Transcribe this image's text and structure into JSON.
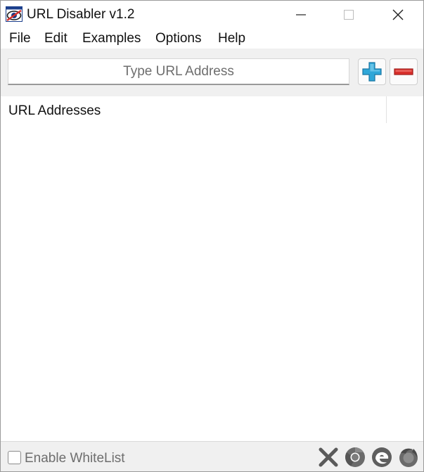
{
  "window": {
    "title": "URL Disabler v1.2"
  },
  "menu": {
    "items": [
      {
        "label": "File"
      },
      {
        "label": "Edit"
      },
      {
        "label": "Examples"
      },
      {
        "label": "Options"
      },
      {
        "label": "Help"
      }
    ]
  },
  "toolbar": {
    "url_placeholder": "Type URL Address",
    "url_value": ""
  },
  "list": {
    "column_header": "URL Addresses",
    "rows": []
  },
  "statusbar": {
    "whitelist_label": "Enable WhiteList",
    "whitelist_checked": false
  },
  "colors": {
    "add_accent": "#2fa7d8",
    "remove_accent": "#d9302c",
    "toolbar_bg": "#f0f0f0",
    "disabled_text": "#6e6e6e"
  },
  "icons": {
    "app": "eye-icon",
    "add": "plus-icon",
    "remove": "minus-icon",
    "browsers": [
      "close-x-icon",
      "chrome-icon",
      "edge-icon",
      "firefox-icon"
    ]
  }
}
